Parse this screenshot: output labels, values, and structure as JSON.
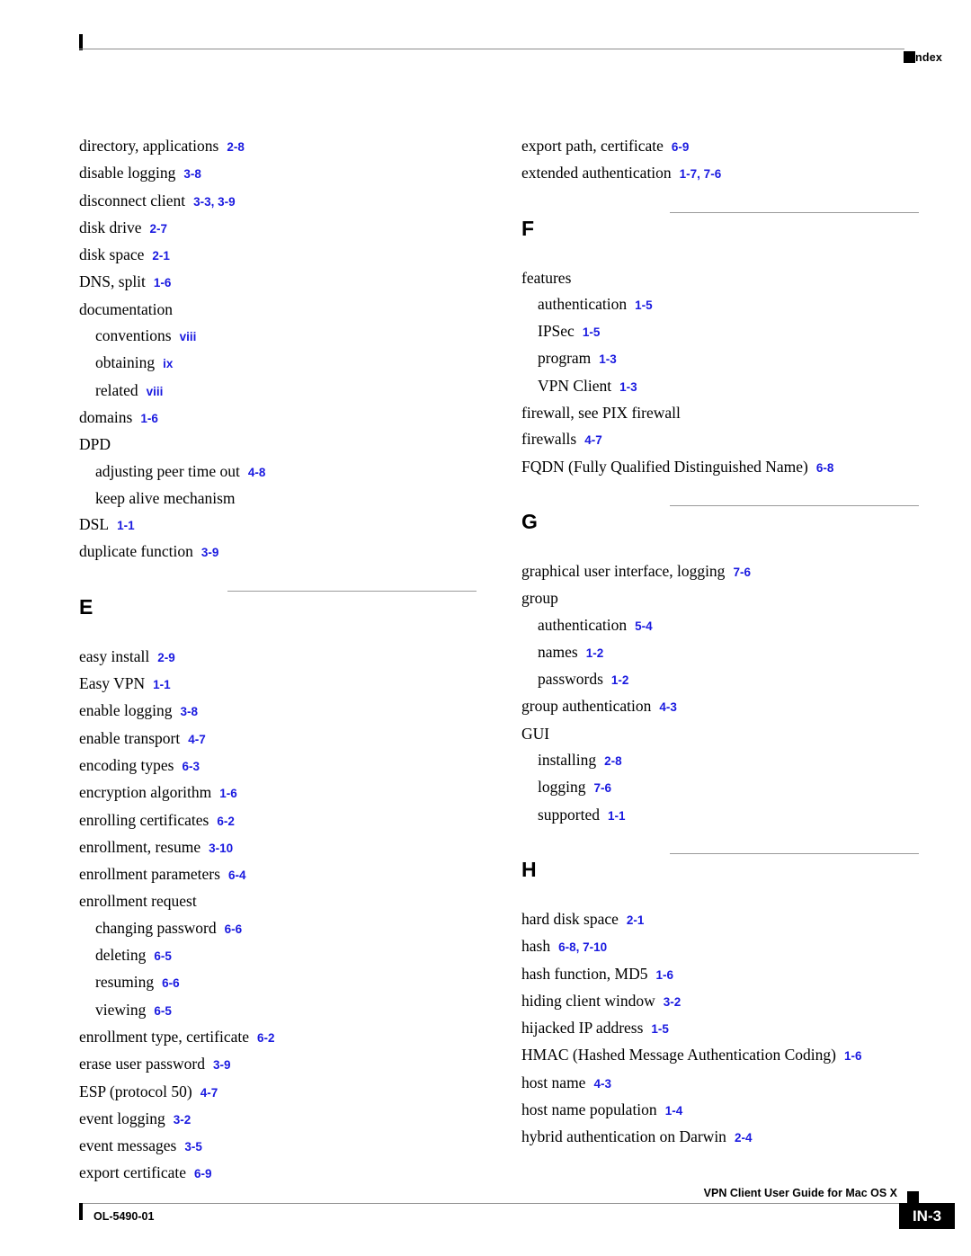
{
  "header": {
    "title": "Index",
    "marker_icon": "black-square-marker"
  },
  "footer": {
    "doc_id": "OL-5490-01",
    "guide_title": "VPN Client User Guide for Mac OS X",
    "page_number": "IN-3",
    "marker_icon": "black-square-marker"
  },
  "colors": {
    "page_reference": "#1a1ae0",
    "rule": "#8d8d8d",
    "text": "#000000"
  },
  "columns": [
    {
      "name": "left-column",
      "blocks": [
        {
          "type": "entries",
          "entries": [
            {
              "term": "directory, applications",
              "refs": "2-8",
              "level": 1
            },
            {
              "term": "disable logging",
              "refs": "3-8",
              "level": 1
            },
            {
              "term": "disconnect client",
              "refs": "3-3, 3-9",
              "level": 1
            },
            {
              "term": "disk drive",
              "refs": "2-7",
              "level": 1
            },
            {
              "term": "disk space",
              "refs": "2-1",
              "level": 1
            },
            {
              "term": "DNS, split",
              "refs": "1-6",
              "level": 1
            },
            {
              "term": "documentation",
              "refs": "",
              "level": 1
            },
            {
              "term": "conventions",
              "refs": "viii",
              "level": 2
            },
            {
              "term": "obtaining",
              "refs": "ix",
              "level": 2
            },
            {
              "term": "related",
              "refs": "viii",
              "level": 2
            },
            {
              "term": "domains",
              "refs": "1-6",
              "level": 1
            },
            {
              "term": "DPD",
              "refs": "",
              "level": 1
            },
            {
              "term": "adjusting peer time out",
              "refs": "4-8",
              "level": 2
            },
            {
              "term": "keep alive mechanism",
              "refs": "",
              "level": 2
            },
            {
              "term": "DSL",
              "refs": "1-1",
              "level": 1
            },
            {
              "term": "duplicate function",
              "refs": "3-9",
              "level": 1
            }
          ]
        },
        {
          "type": "section",
          "letter": "E"
        },
        {
          "type": "entries",
          "entries": [
            {
              "term": "easy install",
              "refs": "2-9",
              "level": 1
            },
            {
              "term": "Easy VPN",
              "refs": "1-1",
              "level": 1
            },
            {
              "term": "enable logging",
              "refs": "3-8",
              "level": 1
            },
            {
              "term": "enable transport",
              "refs": "4-7",
              "level": 1
            },
            {
              "term": "encoding types",
              "refs": "6-3",
              "level": 1
            },
            {
              "term": "encryption algorithm",
              "refs": "1-6",
              "level": 1
            },
            {
              "term": "enrolling certificates",
              "refs": "6-2",
              "level": 1
            },
            {
              "term": "enrollment, resume",
              "refs": "3-10",
              "level": 1
            },
            {
              "term": "enrollment parameters",
              "refs": "6-4",
              "level": 1
            },
            {
              "term": "enrollment request",
              "refs": "",
              "level": 1
            },
            {
              "term": "changing password",
              "refs": "6-6",
              "level": 2
            },
            {
              "term": "deleting",
              "refs": "6-5",
              "level": 2
            },
            {
              "term": "resuming",
              "refs": "6-6",
              "level": 2
            },
            {
              "term": "viewing",
              "refs": "6-5",
              "level": 2
            },
            {
              "term": "enrollment type, certificate",
              "refs": "6-2",
              "level": 1
            },
            {
              "term": "erase user password",
              "refs": "3-9",
              "level": 1
            },
            {
              "term": "ESP (protocol 50)",
              "refs": "4-7",
              "level": 1
            },
            {
              "term": "event logging",
              "refs": "3-2",
              "level": 1
            },
            {
              "term": "event messages",
              "refs": "3-5",
              "level": 1
            },
            {
              "term": "export certificate",
              "refs": "6-9",
              "level": 1
            }
          ]
        }
      ]
    },
    {
      "name": "right-column",
      "blocks": [
        {
          "type": "entries",
          "entries": [
            {
              "term": "export path, certificate",
              "refs": "6-9",
              "level": 1
            },
            {
              "term": "extended authentication",
              "refs": "1-7, 7-6",
              "level": 1
            }
          ]
        },
        {
          "type": "section",
          "letter": "F"
        },
        {
          "type": "entries",
          "entries": [
            {
              "term": "features",
              "refs": "",
              "level": 1
            },
            {
              "term": "authentication",
              "refs": "1-5",
              "level": 2
            },
            {
              "term": "IPSec",
              "refs": "1-5",
              "level": 2
            },
            {
              "term": "program",
              "refs": "1-3",
              "level": 2
            },
            {
              "term": "VPN Client",
              "refs": "1-3",
              "level": 2
            },
            {
              "term": "firewall, see PIX firewall",
              "refs": "",
              "level": 1
            },
            {
              "term": "firewalls",
              "refs": "4-7",
              "level": 1
            },
            {
              "term": "FQDN (Fully Qualified Distinguished Name)",
              "refs": "6-8",
              "level": 1
            }
          ]
        },
        {
          "type": "section",
          "letter": "G"
        },
        {
          "type": "entries",
          "entries": [
            {
              "term": "graphical user interface, logging",
              "refs": "7-6",
              "level": 1
            },
            {
              "term": "group",
              "refs": "",
              "level": 1
            },
            {
              "term": "authentication",
              "refs": "5-4",
              "level": 2
            },
            {
              "term": "names",
              "refs": "1-2",
              "level": 2
            },
            {
              "term": "passwords",
              "refs": "1-2",
              "level": 2
            },
            {
              "term": "group authentication",
              "refs": "4-3",
              "level": 1
            },
            {
              "term": "GUI",
              "refs": "",
              "level": 1
            },
            {
              "term": "installing",
              "refs": "2-8",
              "level": 2
            },
            {
              "term": "logging",
              "refs": "7-6",
              "level": 2
            },
            {
              "term": "supported",
              "refs": "1-1",
              "level": 2
            }
          ]
        },
        {
          "type": "section",
          "letter": "H"
        },
        {
          "type": "entries",
          "entries": [
            {
              "term": "hard disk space",
              "refs": "2-1",
              "level": 1
            },
            {
              "term": "hash",
              "refs": "6-8, 7-10",
              "level": 1
            },
            {
              "term": "hash function, MD5",
              "refs": "1-6",
              "level": 1
            },
            {
              "term": "hiding client window",
              "refs": "3-2",
              "level": 1
            },
            {
              "term": "hijacked IP address",
              "refs": "1-5",
              "level": 1
            },
            {
              "term": "HMAC (Hashed Message Authentication Coding)",
              "refs": "1-6",
              "level": 1
            },
            {
              "term": "host name",
              "refs": "4-3",
              "level": 1
            },
            {
              "term": "host name population",
              "refs": "1-4",
              "level": 1
            },
            {
              "term": "hybrid authentication on Darwin",
              "refs": "2-4",
              "level": 1
            }
          ]
        }
      ]
    }
  ]
}
